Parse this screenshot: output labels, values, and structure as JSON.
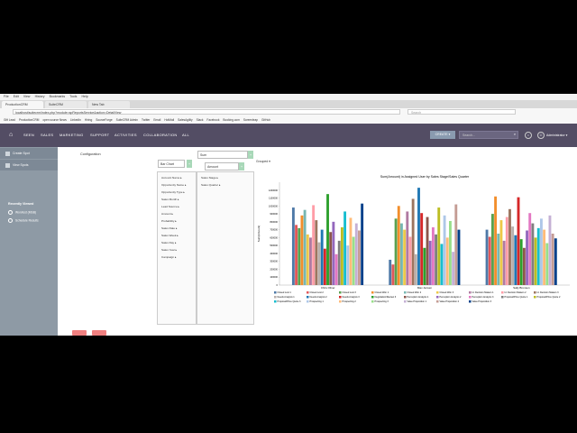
{
  "browser": {
    "menu": [
      "File",
      "Edit",
      "View",
      "History",
      "Bookmarks",
      "Tools",
      "Help"
    ],
    "tabs": [
      "ProductionCRM",
      "SuiteCRM",
      "New Tab"
    ],
    "url": "localhost/suitecrm/index.php?module=spReportsService&action=DetailView",
    "search_placeholder": "Search",
    "bookmarks": [
      "Gift Lead",
      "ProductionCRM",
      "open source News",
      "LinkedIn",
      "Hiring",
      "SourceForge",
      "SuiteCRM Admin",
      "Twitter",
      "Email",
      "HotMail",
      "SalesAgility",
      "Slack",
      "Facebook",
      "Booking.com",
      "Screenleap",
      "GitHub"
    ]
  },
  "nav": {
    "items": [
      "SEEN",
      "SALES",
      "MARKETING",
      "SUPPORT",
      "ACTIVITIES",
      "COLLABORATION",
      "ALL"
    ],
    "create_label": "CREATE ▾",
    "search_placeholder": "Search...",
    "user": "Administrator ▾"
  },
  "sidebar": {
    "actions": [
      "Create Spot",
      "View Spots"
    ],
    "title": "Recently Viewed",
    "items": [
      "Won/lost (MSB)",
      "Schedule Results"
    ]
  },
  "config": {
    "label": "Configuration",
    "chart_type": "Bar Chart",
    "sum_label": "Sum",
    "amount_label": "Amount",
    "grouped_label": "Grouped ▾",
    "fields_left": [
      "Account Name ▸",
      "Opportunity Name ▸",
      "Opportunity Type ▸",
      "Sales Month ▸",
      "Lead Source ▸",
      "Amount ▸",
      "Probability ▸",
      "Sales Date ▸",
      "Sales Week ▸",
      "Sales Day ▸",
      "Sales Year ▸",
      "Campaign ▸"
    ],
    "fields_mid": [
      "Sales Stage ▸",
      "Sales Quarter ▸"
    ]
  },
  "chart_data": {
    "type": "bar",
    "title": "Sum(Amount) in Assigned User by Sales Stage/Sales Quarter",
    "ylabel": "Sum(Amount)",
    "categories": [
      "Chris Oliver",
      "Max Jensen",
      "Sally Bronsen"
    ],
    "ylim": [
      0,
      1300000
    ],
    "yticks": [
      0,
      100000,
      200000,
      300000,
      400000,
      500000,
      600000,
      700000,
      800000,
      900000,
      1000000,
      1100000,
      1200000
    ],
    "series": [
      {
        "name": "Closed Lost 1",
        "color": "#4e79a7",
        "values": [
          980000,
          320000,
          700000
        ]
      },
      {
        "name": "Closed Lost 2",
        "color": "#e15759",
        "values": [
          760000,
          260000,
          610000
        ]
      },
      {
        "name": "Closed Lost 3",
        "color": "#59a14f",
        "values": [
          720000,
          840000,
          900000
        ]
      },
      {
        "name": "Closed Won 1",
        "color": "#f28e2b",
        "values": [
          880000,
          1000000,
          1120000
        ]
      },
      {
        "name": "Closed Won 2",
        "color": "#76b7b2",
        "values": [
          950000,
          780000,
          650000
        ]
      },
      {
        "name": "Closed Won 3",
        "color": "#edc948",
        "values": [
          640000,
          700000,
          820000
        ]
      },
      {
        "name": "Id. Decision Makers 1",
        "color": "#b07aa1",
        "values": [
          600000,
          930000,
          560000
        ]
      },
      {
        "name": "Id. Decision Makers 2",
        "color": "#ff9da7",
        "values": [
          1010000,
          610000,
          860000
        ]
      },
      {
        "name": "Id. Decision Makers 3",
        "color": "#9c755f",
        "values": [
          820000,
          1090000,
          960000
        ]
      },
      {
        "name": "Needs Analysis 1",
        "color": "#bab0ac",
        "values": [
          540000,
          390000,
          740000
        ]
      },
      {
        "name": "Needs Analysis 2",
        "color": "#1f77b4",
        "values": [
          700000,
          1230000,
          630000
        ]
      },
      {
        "name": "Needs Analysis 3",
        "color": "#d62728",
        "values": [
          460000,
          910000,
          1110000
        ]
      },
      {
        "name": "Negotiation/Review 3",
        "color": "#2ca02c",
        "values": [
          1150000,
          470000,
          580000
        ]
      },
      {
        "name": "Perception Analysis 1",
        "color": "#8c564b",
        "values": [
          670000,
          860000,
          470000
        ]
      },
      {
        "name": "Perception Analysis 2",
        "color": "#9467bd",
        "values": [
          800000,
          560000,
          690000
        ]
      },
      {
        "name": "Perception Analysis 3",
        "color": "#e377c2",
        "values": [
          390000,
          730000,
          910000
        ]
      },
      {
        "name": "Proposal/Price Quote 1",
        "color": "#7f7f7f",
        "values": [
          560000,
          640000,
          780000
        ]
      },
      {
        "name": "Proposal/Price Quote 2",
        "color": "#bcbd22",
        "values": [
          730000,
          980000,
          600000
        ]
      },
      {
        "name": "Proposal/Price Quote 3",
        "color": "#17becf",
        "values": [
          930000,
          520000,
          720000
        ]
      },
      {
        "name": "Prospecting 1",
        "color": "#aec7e8",
        "values": [
          500000,
          880000,
          840000
        ]
      },
      {
        "name": "Prospecting 2",
        "color": "#ffbb78",
        "values": [
          850000,
          600000,
          700000
        ]
      },
      {
        "name": "Prospecting 3",
        "color": "#98df8a",
        "values": [
          610000,
          810000,
          530000
        ]
      },
      {
        "name": "Value Proposition 1",
        "color": "#c5b0d5",
        "values": [
          780000,
          420000,
          880000
        ]
      },
      {
        "name": "Value Proposition 2",
        "color": "#c49c94",
        "values": [
          690000,
          1020000,
          650000
        ]
      },
      {
        "name": "Value Proposition 3",
        "color": "#003f8a",
        "values": [
          1030000,
          700000,
          590000
        ]
      }
    ],
    "legend": "bottom",
    "grid": false
  }
}
